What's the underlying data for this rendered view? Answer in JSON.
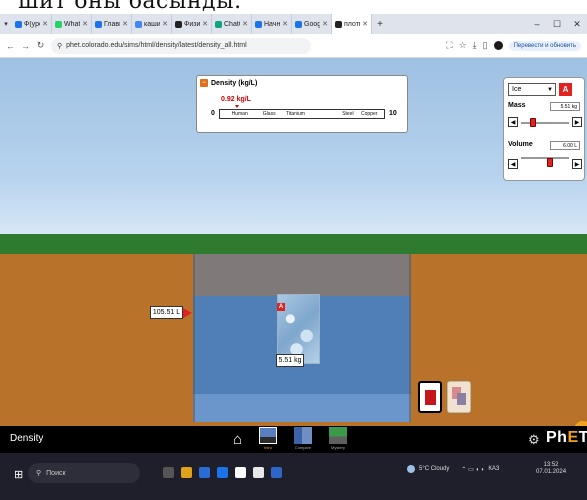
{
  "top_clip_text": "шит оны басынды.",
  "browser": {
    "tabs": [
      {
        "title": "Ф(урок | ...",
        "color": "#1a73e8"
      },
      {
        "title": "WhatsApp",
        "color": "#25d366"
      },
      {
        "title": "Главная",
        "color": "#1a73e8"
      },
      {
        "title": "кашикун",
        "color": "#4285f4"
      },
      {
        "title": "Физику",
        "color": "#222222"
      },
      {
        "title": "ChatGPT",
        "color": "#10a37f"
      },
      {
        "title": "Начните",
        "color": "#1a73e8"
      },
      {
        "title": "Google П",
        "color": "#1a73e8"
      },
      {
        "title": "плотнос",
        "color": "#222222",
        "active": true
      }
    ],
    "url": "phet.colorado.edu/sims/html/density/latest/density_all.html",
    "translate_label": "Перевести и обновить"
  },
  "density_panel": {
    "title": "Density (kg/L)",
    "value": "0.92 kg/L",
    "min": "0",
    "max": "10",
    "materials": [
      "Human",
      "Glass",
      "Titanium",
      "Steel",
      "Copper"
    ]
  },
  "controls": {
    "material": "Ice",
    "mass_label": "Mass",
    "mass_value": "5.51 kg",
    "volume_label": "Volume",
    "volume_value": "6.00 L"
  },
  "pool": {
    "volume_readout": "105.51 L",
    "block_mass": "5.51 kg",
    "block_tag": "A"
  },
  "navbar": {
    "title": "Density",
    "screens": [
      {
        "label": "Intro",
        "active": true
      },
      {
        "label": "Compare",
        "active": false
      },
      {
        "label": "Mystery",
        "active": false
      }
    ],
    "brand": "PhET"
  },
  "taskbar": {
    "search_placeholder": "Поиск",
    "weather": "5°C Cloudy",
    "time": "13:52",
    "date": "07.01.2024",
    "lang": "КАЗ"
  }
}
